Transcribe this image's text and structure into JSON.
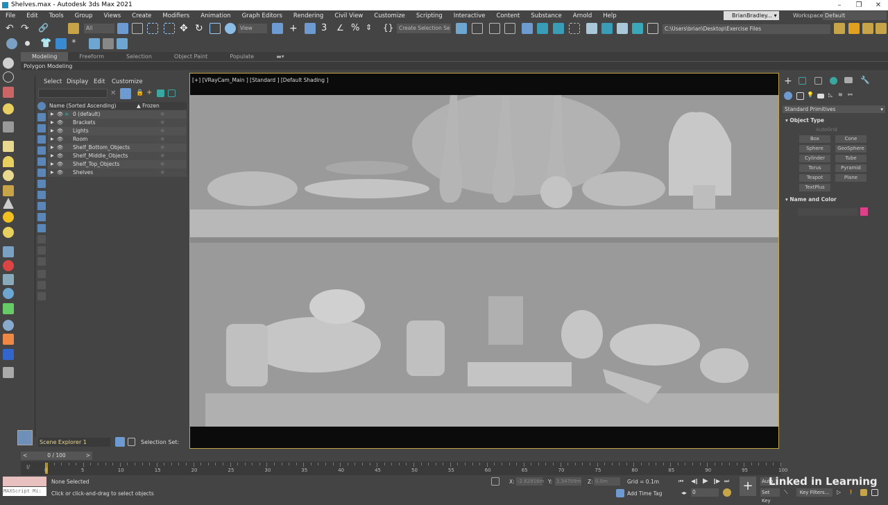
{
  "window": {
    "title": "Shelves.max - Autodesk 3ds Max 2021",
    "minimize": "–",
    "maximize": "❐",
    "close": "✕"
  },
  "menu": [
    "File",
    "Edit",
    "Tools",
    "Group",
    "Views",
    "Create",
    "Modifiers",
    "Animation",
    "Graph Editors",
    "Rendering",
    "Civil View",
    "Customize",
    "Scripting",
    "Interactive",
    "Content",
    "Substance",
    "Arnold",
    "Help"
  ],
  "user": "BrianBradley...",
  "workspaces": {
    "label": "Workspaces:",
    "value": "Default"
  },
  "toolbar": {
    "selection_filter": "All",
    "ref_coord": "View",
    "named_selection": "Create Selection Se",
    "project_path": "C:\\Users\\brian\\Desktop\\Exercise Files"
  },
  "ribbon": {
    "tabs": [
      "Modeling",
      "Freeform",
      "Selection",
      "Object Paint",
      "Populate"
    ],
    "active": "Modeling",
    "panel": "Polygon Modeling"
  },
  "explorer": {
    "menu": [
      "Select",
      "Display",
      "Edit",
      "Customize"
    ],
    "col_name": "Name (Sorted Ascending)",
    "col_frozen": "▲ Frozen",
    "rows": [
      "0 (default)",
      "Brackets",
      "Lights",
      "Room",
      "Shelf_Bottom_Objects",
      "Shelf_Middle_Objects",
      "Shelf_Top_Objects",
      "Shelves"
    ],
    "name": "Scene Explorer 1",
    "selection_set": "Selection Set:"
  },
  "viewport": {
    "label": "[+] [VRayCam_Main ] [Standard ] [Default Shading ]"
  },
  "command_panel": {
    "category": "Standard Primitives",
    "object_type": "Object Type",
    "autogrid": "AutoGrid",
    "buttons": [
      "Box",
      "Cone",
      "Sphere",
      "GeoSphere",
      "Cylinder",
      "Tube",
      "Torus",
      "Pyramid",
      "Teapot",
      "Plane",
      "TextPlus"
    ],
    "name_and_color": "Name and Color",
    "color": "#e0408a"
  },
  "timeline": {
    "frame": "0 / 100",
    "ticks": [
      "0",
      "5",
      "10",
      "15",
      "20",
      "25",
      "30",
      "35",
      "40",
      "45",
      "50",
      "55",
      "60",
      "65",
      "70",
      "75",
      "80",
      "85",
      "90",
      "95",
      "100"
    ]
  },
  "status": {
    "selected": "None Selected",
    "prompt": "Click or click-and-drag to select objects",
    "maxscript": "MAXScript Mi:",
    "x_label": "X:",
    "x": "-2.62916m",
    "y_label": "Y:",
    "y": "1.34709m",
    "z_label": "Z:",
    "z": "0.0m",
    "grid": "Grid = 0.1m",
    "add_time_tag": "Add Time Tag",
    "current_frame": "0",
    "auto_key": "Auto",
    "set_key": "Set Key",
    "key_filters": "Key Filters...",
    "watermark": "Linked in Learning"
  }
}
